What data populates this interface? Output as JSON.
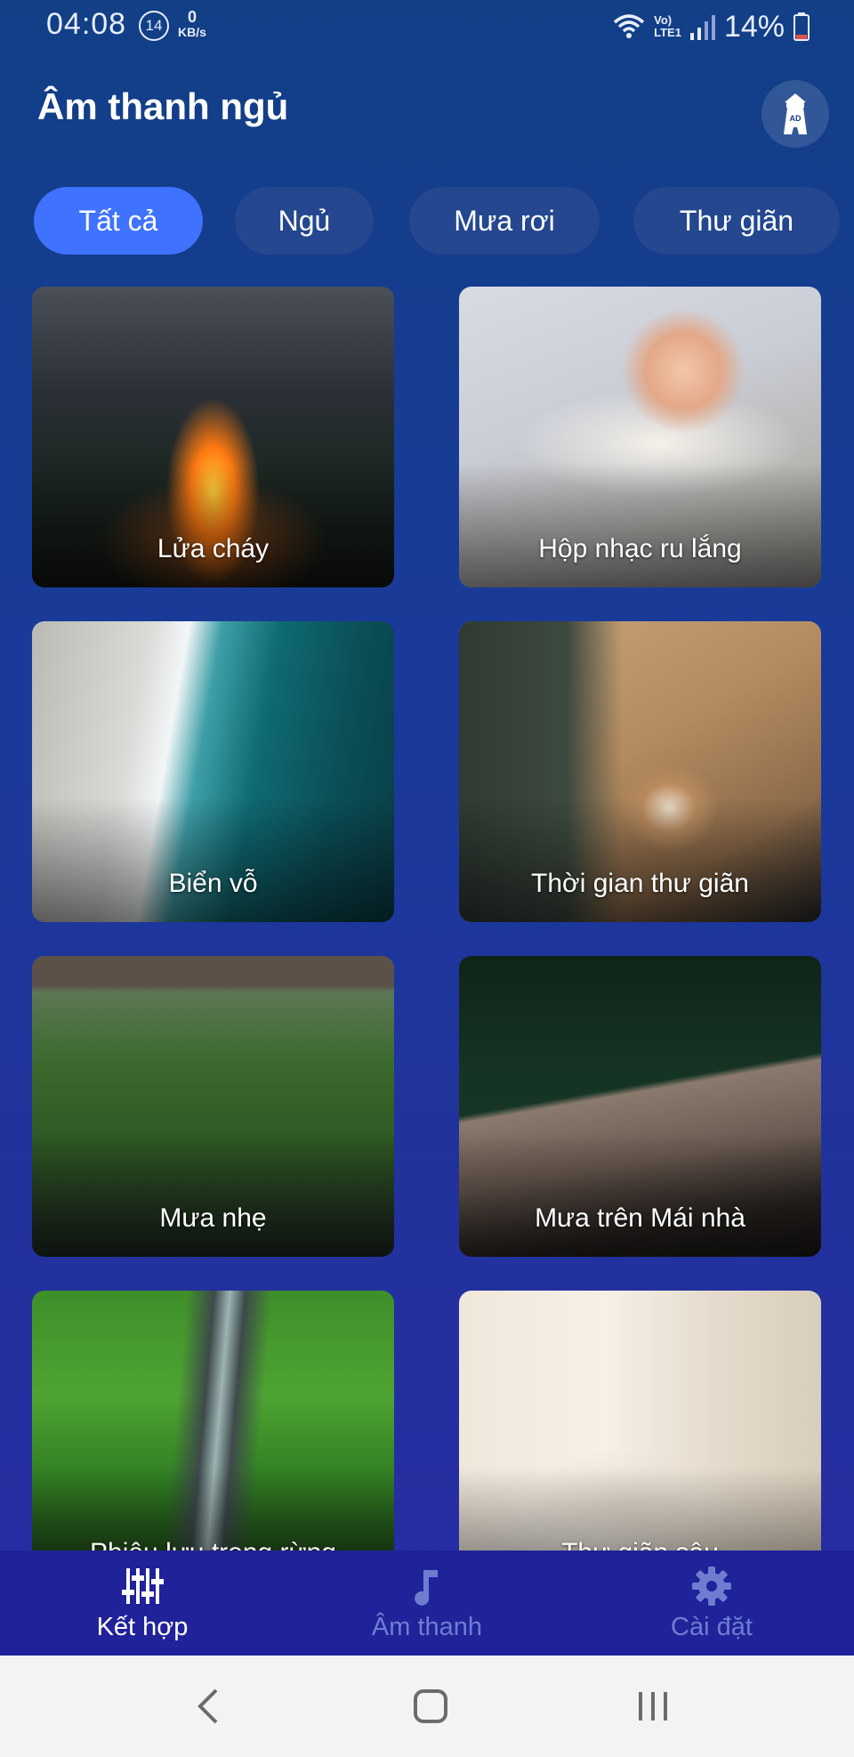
{
  "status_bar": {
    "time": "04:08",
    "notification_count": "14",
    "net_speed_value": "0",
    "net_speed_unit": "KB/s",
    "network_label_top": "Vo)",
    "network_label_bottom": "LTE1",
    "battery": "14%"
  },
  "header": {
    "title": "Âm thanh ngủ",
    "ad_label": "AD"
  },
  "chips": [
    {
      "label": "Tất cả",
      "active": true
    },
    {
      "label": "Ngủ",
      "active": false
    },
    {
      "label": "Mưa rơi",
      "active": false
    },
    {
      "label": "Thư giãn",
      "active": false
    }
  ],
  "cards": [
    {
      "label": "Lửa cháy",
      "image": "campfire"
    },
    {
      "label": "Hộp nhạc ru lắng",
      "image": "sleeping-baby"
    },
    {
      "label": "Biển vỗ",
      "image": "ocean-waves"
    },
    {
      "label": "Thời gian thư giãn",
      "image": "coffee-cup"
    },
    {
      "label": "Mưa nhẹ",
      "image": "rain-garden"
    },
    {
      "label": "Mưa trên Mái nhà",
      "image": "rain-roof"
    },
    {
      "label": "Phiêu lưu trong rừng",
      "image": "forest-stream"
    },
    {
      "label": "Thư giãn sâu",
      "image": "relaxing-woman"
    }
  ],
  "bottom_nav": [
    {
      "label": "Kết hợp",
      "icon": "sliders-icon",
      "active": true
    },
    {
      "label": "Âm thanh",
      "icon": "music-note-icon",
      "active": false
    },
    {
      "label": "Cài đặt",
      "icon": "gear-icon",
      "active": false
    }
  ],
  "colors": {
    "accent": "#3f73ff",
    "chip_bg": "#24478f",
    "nav_bg": "#20229a"
  }
}
